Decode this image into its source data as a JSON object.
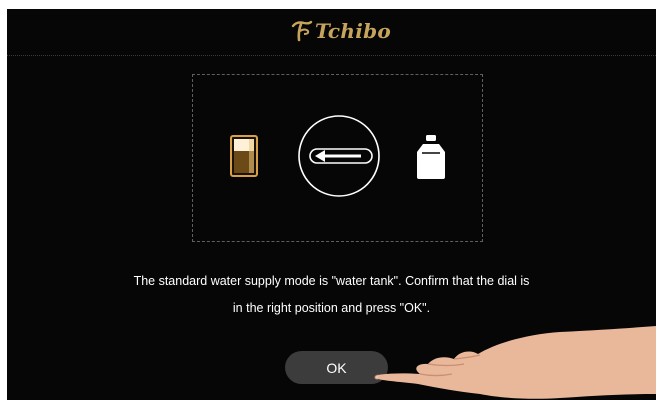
{
  "brand": {
    "name": "Tchibo",
    "accent_color": "#c7a45d"
  },
  "illustration": {
    "left_icon": "water-tank-icon",
    "center_icon": "dial-arrow-left-icon",
    "right_icon": "water-bottle-icon"
  },
  "message": {
    "line1": "The standard water supply mode is \"water tank\". Confirm that the dial is",
    "line2": "in the right position and press \"OK\"."
  },
  "ok_button": {
    "label": "OK"
  },
  "overlay": {
    "icon": "pointing-hand"
  },
  "colors": {
    "background": "#060606",
    "button": "#3c3c3c",
    "text": "#ffffff"
  }
}
